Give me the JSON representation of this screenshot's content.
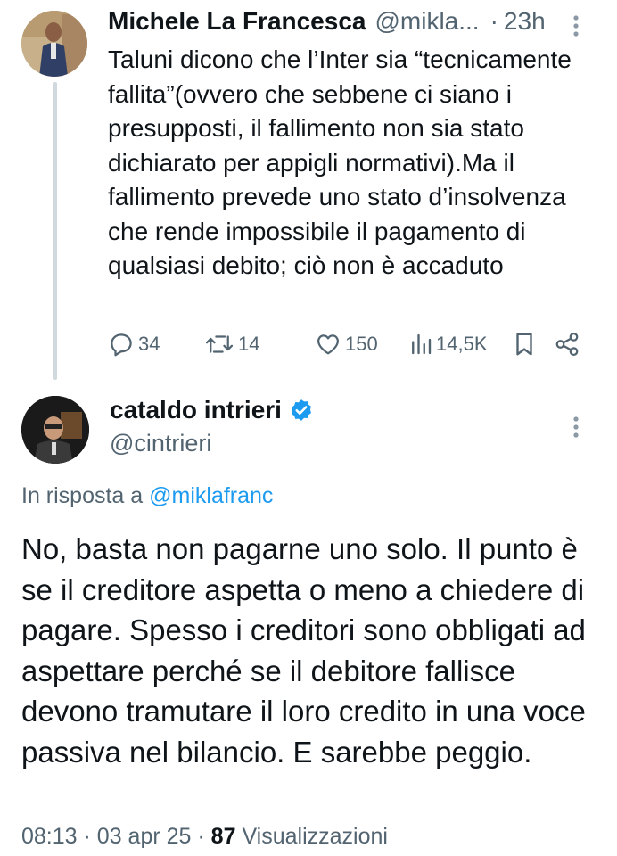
{
  "parent_tweet": {
    "author_name": "Michele La Francesca",
    "author_handle": "@mikla...",
    "separator": "·",
    "time": "23h",
    "text": "Taluni dicono che l’Inter sia “tecnicamente fallita”(ovvero che sebbene ci siano i presupposti, il fallimento non sia stato dichiarato per appigli normativi).Ma il fallimento prevede uno stato d’insolvenza che rende impossibile il pagamento di qualsiasi debito; ciò non è accaduto",
    "actions": {
      "replies": "34",
      "retweets": "14",
      "likes": "150",
      "views": "14,5K"
    }
  },
  "reply_tweet": {
    "author_name": "cataldo intrieri",
    "author_handle": "@cintrieri",
    "reply_to_prefix": "In risposta a",
    "reply_to_handle": "@miklafranc",
    "text": "No, basta non pagarne uno solo. Il punto è se il creditore  aspetta o meno a chiedere di pagare. Spesso i creditori sono obbligati ad aspettare perché se il debitore fallisce devono tramutare il loro credito in una voce passiva nel bilancio. E sarebbe peggio.",
    "time": "08:13",
    "separator": "·",
    "date": "03 apr 25",
    "views_count": "87",
    "views_label": "Visualizzazioni"
  },
  "icons": {
    "reply": "reply-icon",
    "retweet": "retweet-icon",
    "like": "heart-icon",
    "views": "views-bar-chart-icon",
    "bookmark": "bookmark-icon",
    "share": "share-icon",
    "more": "more-vertical-icon",
    "verified": "verified-badge-icon"
  },
  "colors": {
    "text_primary": "#0f1419",
    "text_secondary": "#536471",
    "link": "#1d9bf0",
    "verified": "#1d9bf0",
    "thread_line": "#cfd9de"
  }
}
